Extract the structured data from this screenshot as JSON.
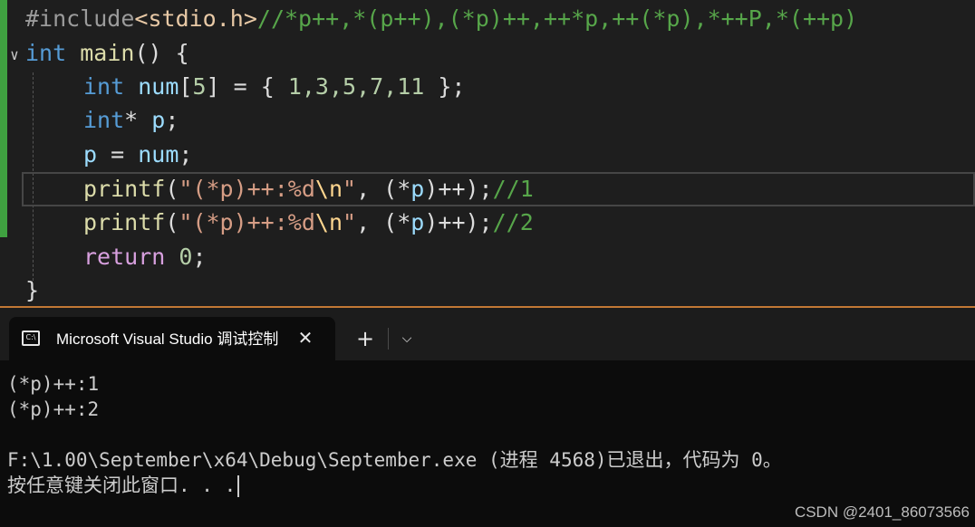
{
  "editor": {
    "line1": {
      "hash": "#include",
      "header": "<stdio.h>",
      "comment": "//*p++,*(p++),(*p)++,++*p,++(*p),*++P,*(++p)"
    },
    "line2": {
      "kw": "int",
      "fn": "main",
      "rest": "() {"
    },
    "line3": {
      "kw": "int",
      "var": "num",
      "open": "[",
      "size": "5",
      "mid": "] = { ",
      "values": "1,3,5,7,11",
      "end": " };"
    },
    "line4": {
      "kw": "int",
      "star": "* ",
      "var": "p",
      "end": ";"
    },
    "line5": {
      "var1": "p",
      "eq": " = ",
      "var2": "num",
      "end": ";"
    },
    "line6": {
      "fn": "printf",
      "open": "(",
      "str1": "\"(*p)++:%d",
      "esc": "\\n",
      "str2": "\"",
      "mid": ", (*",
      "var": "p",
      "end": ")++);",
      "comment": "//1"
    },
    "line7": {
      "fn": "printf",
      "open": "(",
      "str1": "\"(*p)++:%d",
      "esc": "\\n",
      "str2": "\"",
      "mid": ", (*",
      "var": "p",
      "end": ")++);",
      "comment": "//2"
    },
    "line8": {
      "kw": "return",
      "num": "0",
      "end": ";"
    },
    "line9": {
      "text": "}"
    },
    "fold_icon": "chevron-down-icon",
    "fold_glyph": "∨"
  },
  "terminal": {
    "tab_title": "Microsoft Visual Studio 调试控制台",
    "tab_icon": "console-icon",
    "tab_icon_text": "C:\\",
    "close_glyph": "✕",
    "new_tab_glyph": "+",
    "dropdown_glyph": "⌵",
    "output": [
      "(*p)++:1",
      "(*p)++:2",
      "",
      "F:\\1.00\\September\\x64\\Debug\\September.exe (进程 4568)已退出，代码为 0。",
      "按任意键关闭此窗口. . ."
    ]
  },
  "colors": {
    "editor_bg": "#1e1e1e",
    "terminal_bg": "#0c0c0c",
    "change_bar": "#3fa140",
    "accent_line": "#c27835"
  },
  "watermark": "CSDN @2401_86073566"
}
